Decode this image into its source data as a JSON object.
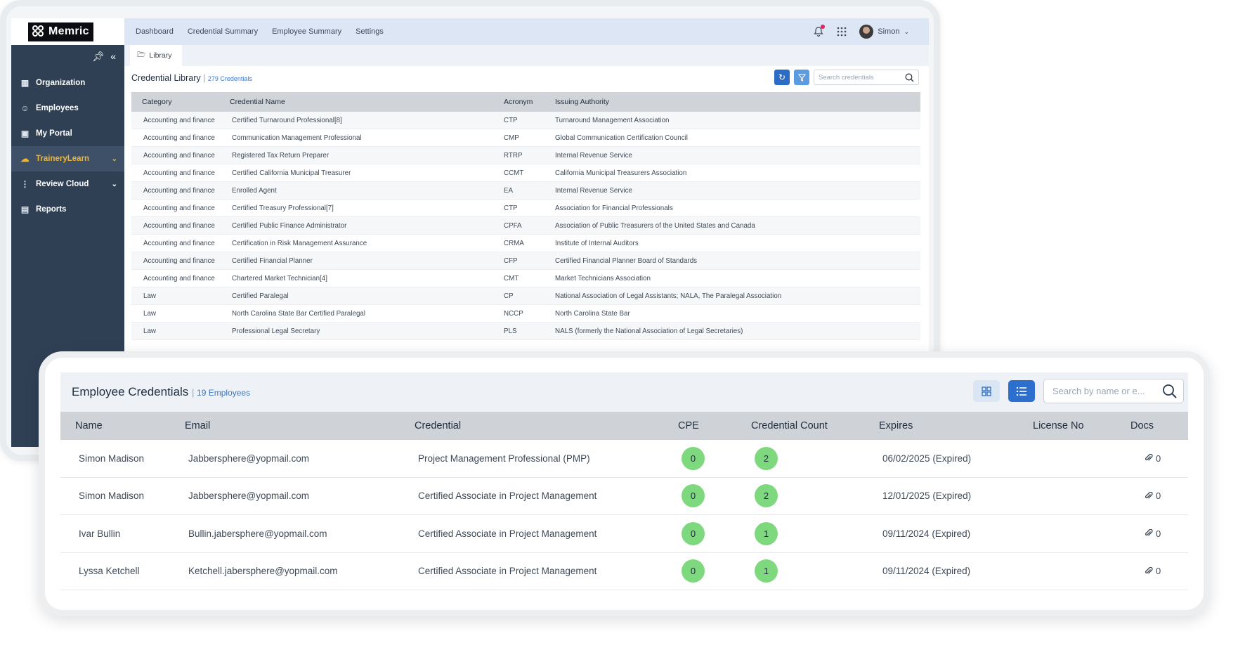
{
  "brand": {
    "name": "Memric"
  },
  "topnav": {
    "items": [
      "Dashboard",
      "Credential Summary",
      "Employee Summary",
      "Settings"
    ],
    "user": "Simon"
  },
  "sidebar": {
    "items": [
      {
        "label": "Organization",
        "icon": "building-icon"
      },
      {
        "label": "Employees",
        "icon": "people-icon"
      },
      {
        "label": "My Portal",
        "icon": "portal-icon"
      },
      {
        "label": "TraineryLearn",
        "icon": "cloud-icon",
        "active": true,
        "expandable": true
      },
      {
        "label": "Review Cloud",
        "icon": "chart-dots-icon",
        "expandable": true
      },
      {
        "label": "Reports",
        "icon": "clipboard-icon"
      }
    ]
  },
  "tab": {
    "label": "Library"
  },
  "library": {
    "title": "Credential Library",
    "count": "279 Credentials",
    "search_placeholder": "Search credentials",
    "columns": [
      "Category",
      "Credential Name",
      "Acronym",
      "Issuing Authority"
    ],
    "rows": [
      [
        "Accounting and finance",
        "Certified Turnaround Professional[8]",
        "CTP",
        "Turnaround Management Association"
      ],
      [
        "Accounting and finance",
        "Communication Management Professional",
        "CMP",
        "Global Communication Certification Council"
      ],
      [
        "Accounting and finance",
        "Registered Tax Return Preparer",
        "RTRP",
        "Internal Revenue Service"
      ],
      [
        "Accounting and finance",
        "Certified California Municipal Treasurer",
        "CCMT",
        "California Municipal Treasurers Association"
      ],
      [
        "Accounting and finance",
        "Enrolled Agent",
        "EA",
        "Internal Revenue Service"
      ],
      [
        "Accounting and finance",
        "Certified Treasury Professional[7]",
        "CTP",
        "Association for Financial Professionals"
      ],
      [
        "Accounting and finance",
        "Certified Public Finance Administrator",
        "CPFA",
        "Association of Public Treasurers of the United States and Canada"
      ],
      [
        "Accounting and finance",
        "Certification in Risk Management Assurance",
        "CRMA",
        "Institute of Internal Auditors"
      ],
      [
        "Accounting and finance",
        "Certified Financial Planner",
        "CFP",
        "Certified Financial Planner Board of Standards"
      ],
      [
        "Accounting and finance",
        "Chartered Market Technician[4]",
        "CMT",
        "Market Technicians Association"
      ],
      [
        "Law",
        "Certified Paralegal",
        "CP",
        "National Association of Legal Assistants; NALA, The Paralegal Association"
      ],
      [
        "Law",
        "North Carolina State Bar Certified Paralegal",
        "NCCP",
        "North Carolina State Bar"
      ],
      [
        "Law",
        "Professional Legal Secretary",
        "PLS",
        "NALS (formerly the National Association of Legal Secretaries)"
      ]
    ]
  },
  "employee_credentials": {
    "title": "Employee Credentials",
    "count": "19 Employees",
    "search_placeholder": "Search by name or e...",
    "columns": [
      "Name",
      "Email",
      "Credential",
      "CPE",
      "Credential Count",
      "Expires",
      "License No",
      "Docs"
    ],
    "rows": [
      [
        "Simon Madison",
        "Jabbersphere@yopmail.com",
        "Project Management Professional (PMP)",
        "0",
        "2",
        "06/02/2025 (Expired)",
        "",
        "0"
      ],
      [
        "Simon Madison",
        "Jabbersphere@yopmail.com",
        "Certified Associate in Project Management",
        "0",
        "2",
        "12/01/2025 (Expired)",
        "",
        "0"
      ],
      [
        "Ivar Bullin",
        "Bullin.jabersphere@yopmail.com",
        "Certified Associate in Project Management",
        "0",
        "1",
        "09/11/2024 (Expired)",
        "",
        "0"
      ],
      [
        "Lyssa Ketchell",
        "Ketchell.jabersphere@yopmail.com",
        "Certified Associate in Project Management",
        "0",
        "1",
        "09/11/2024 (Expired)",
        "",
        "0"
      ]
    ]
  },
  "colors": {
    "sidebar_bg": "#2f4055",
    "sidebar_active_text": "#f1b62b",
    "accent_blue": "#2c6fcf",
    "badge_green": "#7ed87e"
  }
}
